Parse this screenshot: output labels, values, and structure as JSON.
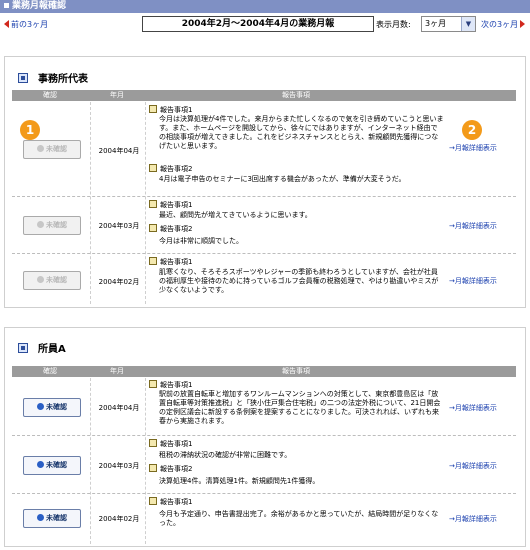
{
  "window_title": "業務月報確認",
  "nav": {
    "prev_label": "前の3ヶ月",
    "period_title": "2004年2月～2004年4月の業務月報",
    "months_label": "表示月数:",
    "months_value": "3ヶ月",
    "next_label": "次の3ヶ月"
  },
  "columns": {
    "confirm": "確認",
    "month": "年月",
    "report": "報告事項"
  },
  "callouts": [
    "1",
    "2"
  ],
  "panels": [
    {
      "title": "事務所代表",
      "rows": [
        {
          "button": "未確認",
          "month": "2004年04月",
          "items": [
            {
              "heading": "報告事項1",
              "text": "今月は決算処理が4件でした。来月からまた忙しくなるので気を引き締めていこうと思います。また、ホームページを開設してから、徐々にではありますが、インターネット経由での相談事項が増えてきました。これをビジネスチャンスととらえ、新規顧問先獲得につなげたいと思います。"
            },
            {
              "heading": "報告事項2",
              "text": "4月は電子申告のセミナーに3回出席する機会があったが、準備が大変そうだ。"
            }
          ],
          "detail": "→月報詳細表示"
        },
        {
          "button": "未確認",
          "month": "2004年03月",
          "items": [
            {
              "heading": "報告事項1",
              "text": "最近、顧問先が増えてきているように思います。"
            },
            {
              "heading": "報告事項2",
              "text": "今月は非常に順調でした。"
            }
          ],
          "detail": "→月報詳細表示"
        },
        {
          "button": "未確認",
          "month": "2004年02月",
          "items": [
            {
              "heading": "報告事項1",
              "text": "肌寒くなり、そろそろスポーツやレジャーの季節も終わろうとしていますが、会社が社員の福利厚生や接待のために持っているゴルフ会員権の税務処理で、やはり勘違いやミスが少なくないようです。"
            }
          ],
          "detail": "→月報詳細表示"
        }
      ]
    },
    {
      "title": "所員A",
      "rows": [
        {
          "button": "未確認",
          "month": "2004年04月",
          "items": [
            {
              "heading": "報告事項1",
              "text": "駅前の放置自転車と増加するワンルームマンションへの対策として、東京都豊島区は「放置自転車等対策推進税」と「狭小住戸集合住宅税」の二つの法定外税について、21日開会の定例区議会に新設する条例案を提案することになりました。可決されれば、いずれも来春から実施されます。"
            }
          ],
          "detail": "→月報詳細表示"
        },
        {
          "button": "未確認",
          "month": "2004年03月",
          "items": [
            {
              "heading": "報告事項1",
              "text": "租税の滞納状況の確認が非常に困難です。"
            },
            {
              "heading": "報告事項2",
              "text": "決算処理4件。清算処理1件。新規顧問先1件獲得。"
            }
          ],
          "detail": "→月報詳細表示"
        },
        {
          "button": "未確認",
          "month": "2004年02月",
          "items": [
            {
              "heading": "報告事項1",
              "text": "今月も予定通り、申告書提出完了。余裕があるかと思っていたが、結局時間が足りなくなった。"
            }
          ],
          "detail": "→月報詳細表示"
        }
      ]
    }
  ]
}
